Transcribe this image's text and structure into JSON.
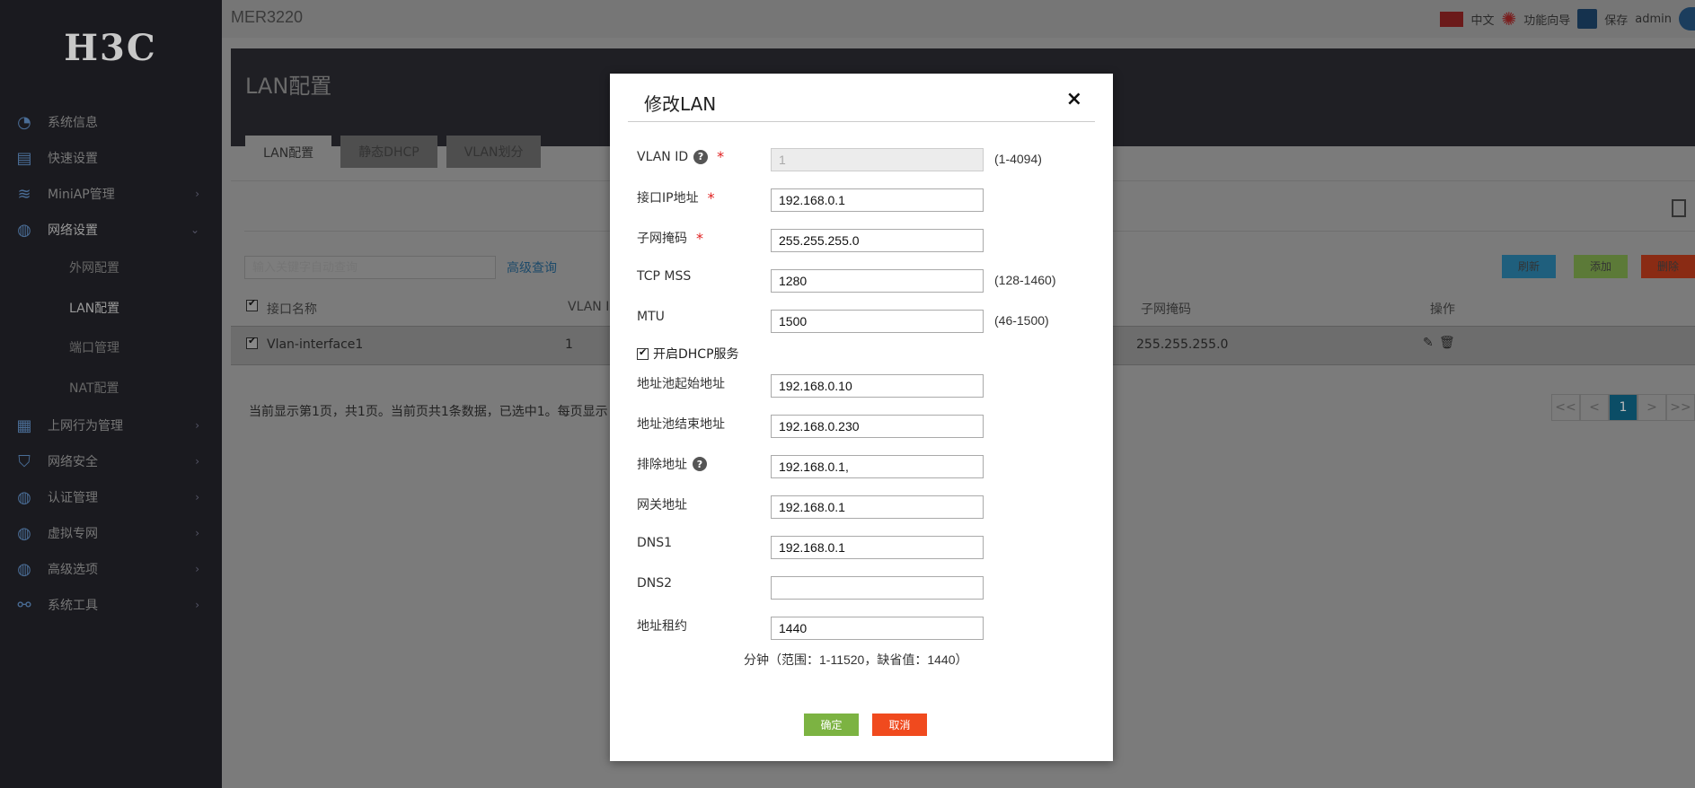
{
  "app": {
    "logo": "H3C",
    "model": "MER3220"
  },
  "topbar": {
    "language": "中文",
    "wizard": "功能向导",
    "save": "保存",
    "user": "admin"
  },
  "sidebar": {
    "items": [
      {
        "label": "系统信息",
        "icon": "dashboard-icon"
      },
      {
        "label": "快速设置",
        "icon": "quick-setup-icon"
      },
      {
        "label": "MiniAP管理",
        "icon": "wifi-icon"
      },
      {
        "label": "网络设置",
        "icon": "globe-icon"
      },
      {
        "label": "外网配置"
      },
      {
        "label": "LAN配置"
      },
      {
        "label": "端口管理"
      },
      {
        "label": "NAT配置"
      },
      {
        "label": "上网行为管理",
        "icon": "table-icon"
      },
      {
        "label": "网络安全",
        "icon": "shield-icon"
      },
      {
        "label": "认证管理",
        "icon": "globe-icon"
      },
      {
        "label": "虚拟专网",
        "icon": "globe-icon"
      },
      {
        "label": "高级选项",
        "icon": "globe-icon"
      },
      {
        "label": "系统工具",
        "icon": "link-icon"
      }
    ]
  },
  "page": {
    "title": "LAN配置",
    "tabs": [
      "LAN配置",
      "静态DHCP",
      "VLAN划分"
    ],
    "search_placeholder": "输入关键字自动查询",
    "advanced_search": "高级查询",
    "buttons": {
      "refresh": "刷新",
      "add": "添加",
      "delete": "删除"
    },
    "table": {
      "headers": [
        "接口名称",
        "VLAN ID",
        "子网掩码",
        "操作"
      ],
      "rows": [
        {
          "name": "Vlan-interface1",
          "vlan": "1",
          "mask": "255.255.255.0"
        }
      ]
    },
    "footer": "当前显示第1页，共1页。当前页共1条数据，已选中1。每页显示：",
    "pager": [
      "<<",
      "<",
      "1",
      ">",
      ">>"
    ]
  },
  "modal": {
    "title": "修改LAN",
    "close": "×",
    "fields": {
      "vlan_id": {
        "label": "VLAN ID",
        "value": "1",
        "hint": "(1-4094)"
      },
      "ip": {
        "label": "接口IP地址",
        "value": "192.168.0.1"
      },
      "mask": {
        "label": "子网掩码",
        "value": "255.255.255.0"
      },
      "tcp_mss": {
        "label": "TCP MSS",
        "value": "1280",
        "hint": "(128-1460)"
      },
      "mtu": {
        "label": "MTU",
        "value": "1500",
        "hint": "(46-1500)"
      },
      "dhcp": {
        "label": "开启DHCP服务",
        "checked": true
      },
      "pool_start": {
        "label": "地址池起始地址",
        "value": "192.168.0.10"
      },
      "pool_end": {
        "label": "地址池结束地址",
        "value": "192.168.0.230"
      },
      "exclude": {
        "label": "排除地址",
        "value": "192.168.0.1,"
      },
      "gateway": {
        "label": "网关地址",
        "value": "192.168.0.1"
      },
      "dns1": {
        "label": "DNS1",
        "value": "192.168.0.1"
      },
      "dns2": {
        "label": "DNS2",
        "value": ""
      },
      "lease": {
        "label": "地址租约",
        "value": "1440",
        "hint": "分钟（范围：1-11520，缺省值：1440）"
      }
    },
    "ok": "确定",
    "cancel": "取消"
  }
}
